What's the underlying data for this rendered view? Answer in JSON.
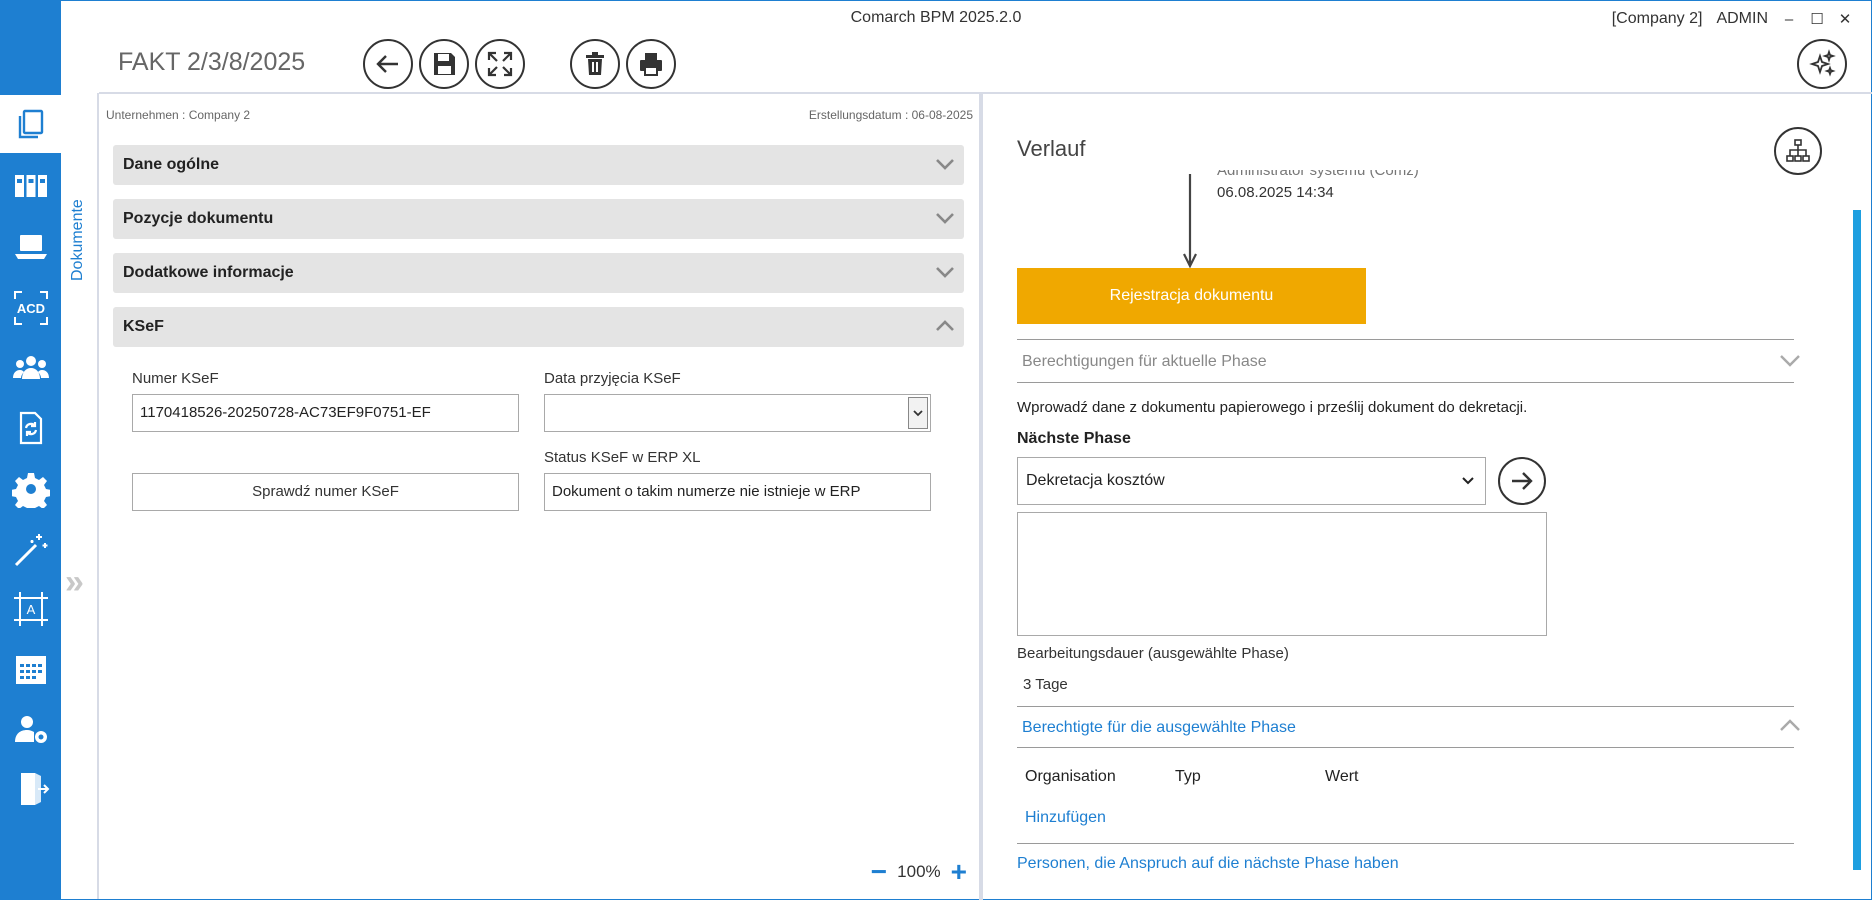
{
  "window": {
    "app_title": "Comarch BPM 2025.2.0",
    "company": "[Company 2]",
    "user": "ADMIN",
    "controls": [
      "–",
      "☐",
      "✕"
    ]
  },
  "sidebar": {
    "items": [
      {
        "name": "documents",
        "icon": "documents-icon",
        "active": true
      },
      {
        "name": "binders",
        "icon": "binders-icon"
      },
      {
        "name": "workstation",
        "icon": "laptop-icon"
      },
      {
        "name": "acd",
        "icon": "acd-icon",
        "label": "ACD"
      },
      {
        "name": "users",
        "icon": "users-icon"
      },
      {
        "name": "sync-document",
        "icon": "document-sync-icon"
      },
      {
        "name": "settings",
        "icon": "gear-icon"
      },
      {
        "name": "wizard",
        "icon": "magic-wand-icon"
      },
      {
        "name": "ocr-template",
        "icon": "ocr-frame-icon",
        "label": "A"
      },
      {
        "name": "calendar",
        "icon": "calendar-icon"
      },
      {
        "name": "user-settings",
        "icon": "user-gear-icon"
      },
      {
        "name": "logout",
        "icon": "exit-door-icon"
      }
    ]
  },
  "vertical_tab": {
    "label": "Dokumente",
    "expand": "»"
  },
  "header": {
    "doc_title": "FAKT 2/3/8/2025",
    "toolbar": [
      "back-arrow-icon",
      "save-disk-icon",
      "fullscreen-icon",
      "delete-trash-icon",
      "print-icon",
      "ai-sparkles-icon"
    ]
  },
  "left": {
    "company_meta": "Unternehmen : Company 2",
    "date_meta": "Erstellungsdatum : 06-08-2025",
    "sections": [
      {
        "label": "Dane ogólne",
        "expanded": false
      },
      {
        "label": "Pozycje dokumentu",
        "expanded": false
      },
      {
        "label": "Dodatkowe informacje",
        "expanded": false
      },
      {
        "label": "KSeF",
        "expanded": true
      }
    ],
    "ksef": {
      "numer_label": "Numer KSeF",
      "numer_value": "1170418526-20250728-AC73EF9F0751-EF",
      "data_label": "Data przyjęcia KSeF",
      "data_value": "",
      "status_label": "Status KSeF w ERP XL",
      "status_value": "Dokument o takim numerze nie istnieje w ERP",
      "check_button": "Sprawdź numer KSeF"
    },
    "zoom": {
      "minus": "−",
      "value": "100%",
      "plus": "+"
    }
  },
  "right": {
    "title": "Verlauf",
    "history": {
      "user": "Administrator systemu (Comz)",
      "date": "06.08.2025 14:34",
      "phase": "Rejestracja dokumentu"
    },
    "permissions_current": "Berechtigungen für aktuelle Phase",
    "instruction": "Wprowadź dane z dokumentu papierowego i prześlij dokument do dekretacji.",
    "next_phase_label": "Nächste Phase",
    "next_phase_value": "Dekretacja kosztów",
    "duration_label": "Bearbeitungsdauer (ausgewählte Phase)",
    "duration_value": "3 Tage",
    "authorized_title": "Berechtigte für die ausgewählte Phase",
    "table_headers": [
      "Organisation",
      "Typ",
      "Wert"
    ],
    "add_link": "Hinzufügen",
    "persons_link": "Personen, die Anspruch auf die nächste Phase haben"
  },
  "colors": {
    "sidebar": "#1e7fd1",
    "phase": "#f0a800",
    "link": "#1e7fd1",
    "section_bg": "#e4e4e4"
  }
}
